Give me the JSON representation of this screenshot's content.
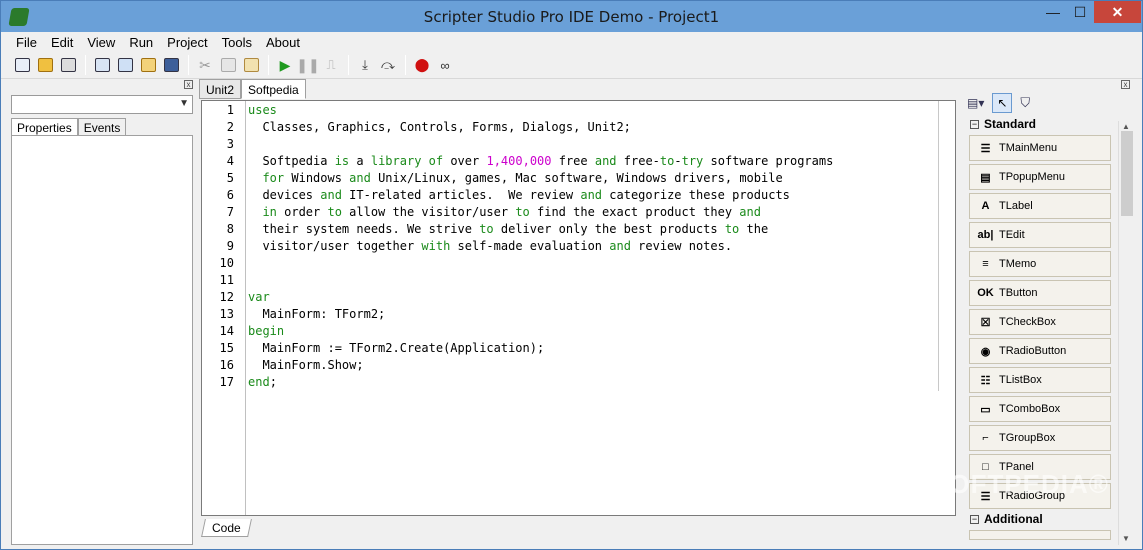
{
  "window": {
    "title": "Scripter Studio Pro IDE Demo - Project1",
    "minimize": "—",
    "maximize": "☐",
    "close": "✕"
  },
  "menu": [
    "File",
    "Edit",
    "View",
    "Run",
    "Project",
    "Tools",
    "About"
  ],
  "left_panel": {
    "tabs": [
      "Properties",
      "Events"
    ],
    "close": "x"
  },
  "editor": {
    "tabs": [
      "Unit2",
      "Softpedia"
    ],
    "active_tab": "Softpedia",
    "bottom_tab": "Code",
    "line_numbers": [
      "1",
      "2",
      "3",
      "4",
      "5",
      "6",
      "7",
      "8",
      "9",
      "10",
      "11",
      "12",
      "13",
      "14",
      "15",
      "16",
      "17"
    ],
    "lines": [
      [
        {
          "t": "uses",
          "c": "kw"
        }
      ],
      [
        {
          "t": "  Classes, Graphics, Controls, Forms, Dialogs, Unit2;",
          "c": ""
        }
      ],
      [
        {
          "t": "",
          "c": ""
        }
      ],
      [
        {
          "t": "  Softpedia ",
          "c": ""
        },
        {
          "t": "is",
          "c": "kw"
        },
        {
          "t": " a ",
          "c": ""
        },
        {
          "t": "library",
          "c": "kw"
        },
        {
          "t": " ",
          "c": ""
        },
        {
          "t": "of",
          "c": "kw"
        },
        {
          "t": " over ",
          "c": ""
        },
        {
          "t": "1,400,000",
          "c": "num"
        },
        {
          "t": " free ",
          "c": ""
        },
        {
          "t": "and",
          "c": "kw"
        },
        {
          "t": " free-",
          "c": ""
        },
        {
          "t": "to",
          "c": "kw"
        },
        {
          "t": "-",
          "c": ""
        },
        {
          "t": "try",
          "c": "kw"
        },
        {
          "t": " software programs",
          "c": ""
        }
      ],
      [
        {
          "t": "  ",
          "c": ""
        },
        {
          "t": "for",
          "c": "kw"
        },
        {
          "t": " Windows ",
          "c": ""
        },
        {
          "t": "and",
          "c": "kw"
        },
        {
          "t": " Unix/Linux, games, Mac software, Windows drivers, mobile",
          "c": ""
        }
      ],
      [
        {
          "t": "  devices ",
          "c": ""
        },
        {
          "t": "and",
          "c": "kw"
        },
        {
          "t": " IT-related articles.  We review ",
          "c": ""
        },
        {
          "t": "and",
          "c": "kw"
        },
        {
          "t": " categorize these products",
          "c": ""
        }
      ],
      [
        {
          "t": "  ",
          "c": ""
        },
        {
          "t": "in",
          "c": "kw"
        },
        {
          "t": " order ",
          "c": ""
        },
        {
          "t": "to",
          "c": "kw"
        },
        {
          "t": " allow the visitor/user ",
          "c": ""
        },
        {
          "t": "to",
          "c": "kw"
        },
        {
          "t": " find the exact product they ",
          "c": ""
        },
        {
          "t": "and",
          "c": "kw"
        }
      ],
      [
        {
          "t": "  their system needs. We strive ",
          "c": ""
        },
        {
          "t": "to",
          "c": "kw"
        },
        {
          "t": " deliver only the best products ",
          "c": ""
        },
        {
          "t": "to",
          "c": "kw"
        },
        {
          "t": " the",
          "c": ""
        }
      ],
      [
        {
          "t": "  visitor/user together ",
          "c": ""
        },
        {
          "t": "with",
          "c": "kw"
        },
        {
          "t": " self-made evaluation ",
          "c": ""
        },
        {
          "t": "and",
          "c": "kw"
        },
        {
          "t": " review notes.",
          "c": ""
        }
      ],
      [
        {
          "t": "",
          "c": ""
        }
      ],
      [
        {
          "t": "",
          "c": ""
        }
      ],
      [
        {
          "t": "var",
          "c": "kw"
        }
      ],
      [
        {
          "t": "  MainForm: TForm2;",
          "c": ""
        }
      ],
      [
        {
          "t": "begin",
          "c": "kw"
        }
      ],
      [
        {
          "t": "  MainForm := TForm2.Create(Application);",
          "c": ""
        }
      ],
      [
        {
          "t": "  MainForm.Show;",
          "c": ""
        }
      ],
      [
        {
          "t": "end",
          "c": "kw"
        },
        {
          "t": ";",
          "c": ""
        }
      ]
    ]
  },
  "palette": {
    "groups": [
      "Standard",
      "Additional"
    ],
    "group_toggle": "−",
    "components": [
      {
        "label": "TMainMenu",
        "icon": "main-menu-icon",
        "glyph": "☰"
      },
      {
        "label": "TPopupMenu",
        "icon": "popup-menu-icon",
        "glyph": "▤"
      },
      {
        "label": "TLabel",
        "icon": "label-icon",
        "glyph": "A"
      },
      {
        "label": "TEdit",
        "icon": "edit-icon",
        "glyph": "ab|"
      },
      {
        "label": "TMemo",
        "icon": "memo-icon",
        "glyph": "≡"
      },
      {
        "label": "TButton",
        "icon": "button-icon",
        "glyph": "OK"
      },
      {
        "label": "TCheckBox",
        "icon": "checkbox-icon",
        "glyph": "☒"
      },
      {
        "label": "TRadioButton",
        "icon": "radiobutton-icon",
        "glyph": "◉"
      },
      {
        "label": "TListBox",
        "icon": "listbox-icon",
        "glyph": "☷"
      },
      {
        "label": "TComboBox",
        "icon": "combobox-icon",
        "glyph": "▭"
      },
      {
        "label": "TGroupBox",
        "icon": "groupbox-icon",
        "glyph": "⌐"
      },
      {
        "label": "TPanel",
        "icon": "panel-icon",
        "glyph": "□"
      },
      {
        "label": "TRadioGroup",
        "icon": "radiogroup-icon",
        "glyph": "☰"
      }
    ]
  },
  "watermark": "SOFTPEDIA®"
}
